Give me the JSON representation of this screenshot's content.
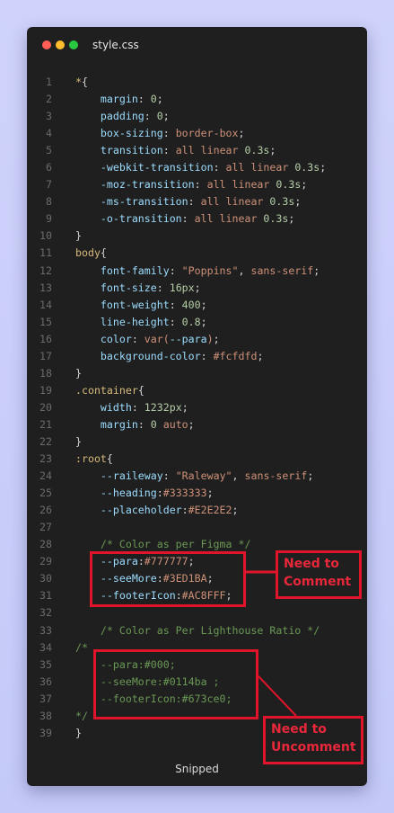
{
  "window": {
    "filename": "style.css",
    "footer": "Snipped"
  },
  "annotations": {
    "comment_label_1": "Need to",
    "comment_label_2": "Comment",
    "uncomment_label_1": "Need to",
    "uncomment_label_2": "Uncomment",
    "annotation_color": "#e0142a"
  },
  "code_lines": [
    {
      "n": "1",
      "parts": [
        [
          "sel",
          "*"
        ],
        [
          "punc",
          "{"
        ]
      ]
    },
    {
      "n": "2",
      "parts": [
        [
          "prop",
          "    margin"
        ],
        [
          "punc",
          ": "
        ],
        [
          "num",
          "0"
        ],
        [
          "punc",
          ";"
        ]
      ]
    },
    {
      "n": "3",
      "parts": [
        [
          "prop",
          "    padding"
        ],
        [
          "punc",
          ": "
        ],
        [
          "num",
          "0"
        ],
        [
          "punc",
          ";"
        ]
      ]
    },
    {
      "n": "4",
      "parts": [
        [
          "prop",
          "    box-sizing"
        ],
        [
          "punc",
          ": "
        ],
        [
          "val",
          "border-box"
        ],
        [
          "punc",
          ";"
        ]
      ]
    },
    {
      "n": "5",
      "parts": [
        [
          "prop",
          "    transition"
        ],
        [
          "punc",
          ": "
        ],
        [
          "val",
          "all linear "
        ],
        [
          "num",
          "0.3s"
        ],
        [
          "punc",
          ";"
        ]
      ]
    },
    {
      "n": "6",
      "parts": [
        [
          "prop",
          "    -webkit-transition"
        ],
        [
          "punc",
          ": "
        ],
        [
          "val",
          "all linear "
        ],
        [
          "num",
          "0.3s"
        ],
        [
          "punc",
          ";"
        ]
      ]
    },
    {
      "n": "7",
      "parts": [
        [
          "prop",
          "    -moz-transition"
        ],
        [
          "punc",
          ": "
        ],
        [
          "val",
          "all linear "
        ],
        [
          "num",
          "0.3s"
        ],
        [
          "punc",
          ";"
        ]
      ]
    },
    {
      "n": "8",
      "parts": [
        [
          "prop",
          "    -ms-transition"
        ],
        [
          "punc",
          ": "
        ],
        [
          "val",
          "all linear "
        ],
        [
          "num",
          "0.3s"
        ],
        [
          "punc",
          ";"
        ]
      ]
    },
    {
      "n": "9",
      "parts": [
        [
          "prop",
          "    -o-transition"
        ],
        [
          "punc",
          ": "
        ],
        [
          "val",
          "all linear "
        ],
        [
          "num",
          "0.3s"
        ],
        [
          "punc",
          ";"
        ]
      ]
    },
    {
      "n": "10",
      "parts": [
        [
          "punc",
          "}"
        ]
      ]
    },
    {
      "n": "11",
      "parts": [
        [
          "sel",
          "body"
        ],
        [
          "punc",
          "{"
        ]
      ]
    },
    {
      "n": "12",
      "parts": [
        [
          "prop",
          "    font-family"
        ],
        [
          "punc",
          ": "
        ],
        [
          "str",
          "\"Poppins\""
        ],
        [
          "punc",
          ", "
        ],
        [
          "val",
          "sans-serif"
        ],
        [
          "punc",
          ";"
        ]
      ]
    },
    {
      "n": "13",
      "parts": [
        [
          "prop",
          "    font-size"
        ],
        [
          "punc",
          ": "
        ],
        [
          "num",
          "16px"
        ],
        [
          "punc",
          ";"
        ]
      ]
    },
    {
      "n": "14",
      "parts": [
        [
          "prop",
          "    font-weight"
        ],
        [
          "punc",
          ": "
        ],
        [
          "num",
          "400"
        ],
        [
          "punc",
          ";"
        ]
      ]
    },
    {
      "n": "15",
      "parts": [
        [
          "prop",
          "    line-height"
        ],
        [
          "punc",
          ": "
        ],
        [
          "num",
          "0.8"
        ],
        [
          "punc",
          ";"
        ]
      ]
    },
    {
      "n": "16",
      "parts": [
        [
          "prop",
          "    color"
        ],
        [
          "punc",
          ": "
        ],
        [
          "val",
          "var("
        ],
        [
          "prop",
          "--para"
        ],
        [
          "val",
          ")"
        ],
        [
          "punc",
          ";"
        ]
      ]
    },
    {
      "n": "17",
      "parts": [
        [
          "prop",
          "    background-color"
        ],
        [
          "punc",
          ": "
        ],
        [
          "val",
          "#fcfdfd"
        ],
        [
          "punc",
          ";"
        ]
      ]
    },
    {
      "n": "18",
      "parts": [
        [
          "punc",
          "}"
        ]
      ]
    },
    {
      "n": "19",
      "parts": [
        [
          "sel",
          ".container"
        ],
        [
          "punc",
          "{"
        ]
      ]
    },
    {
      "n": "20",
      "parts": [
        [
          "prop",
          "    width"
        ],
        [
          "punc",
          ": "
        ],
        [
          "num",
          "1232px"
        ],
        [
          "punc",
          ";"
        ]
      ]
    },
    {
      "n": "21",
      "parts": [
        [
          "prop",
          "    margin"
        ],
        [
          "punc",
          ": "
        ],
        [
          "num",
          "0"
        ],
        [
          "val",
          " auto"
        ],
        [
          "punc",
          ";"
        ]
      ]
    },
    {
      "n": "22",
      "parts": [
        [
          "punc",
          "}"
        ]
      ]
    },
    {
      "n": "23",
      "parts": [
        [
          "sel",
          ":root"
        ],
        [
          "punc",
          "{"
        ]
      ]
    },
    {
      "n": "24",
      "parts": [
        [
          "prop",
          "    --raileway"
        ],
        [
          "punc",
          ": "
        ],
        [
          "str",
          "\"Raleway\""
        ],
        [
          "punc",
          ", "
        ],
        [
          "val",
          "sans-serif"
        ],
        [
          "punc",
          ";"
        ]
      ]
    },
    {
      "n": "25",
      "parts": [
        [
          "prop",
          "    --heading"
        ],
        [
          "punc",
          ":"
        ],
        [
          "val",
          "#333333"
        ],
        [
          "punc",
          ";"
        ]
      ]
    },
    {
      "n": "26",
      "parts": [
        [
          "prop",
          "    --placeholder"
        ],
        [
          "punc",
          ":"
        ],
        [
          "val",
          "#E2E2E2"
        ],
        [
          "punc",
          ";"
        ]
      ]
    },
    {
      "n": "27",
      "parts": []
    },
    {
      "n": "28",
      "parts": [
        [
          "cmt",
          "    /* Color as per Figma */"
        ]
      ]
    },
    {
      "n": "29",
      "parts": [
        [
          "prop",
          "    --para"
        ],
        [
          "punc",
          ":"
        ],
        [
          "val",
          "#777777"
        ],
        [
          "punc",
          ";"
        ]
      ]
    },
    {
      "n": "30",
      "parts": [
        [
          "prop",
          "    --seeMore"
        ],
        [
          "punc",
          ":"
        ],
        [
          "val",
          "#3ED1BA"
        ],
        [
          "punc",
          ";"
        ]
      ]
    },
    {
      "n": "31",
      "parts": [
        [
          "prop",
          "    --footerIcon"
        ],
        [
          "punc",
          ":"
        ],
        [
          "val",
          "#AC8FFF"
        ],
        [
          "punc",
          ";"
        ]
      ]
    },
    {
      "n": "32",
      "parts": []
    },
    {
      "n": "33",
      "parts": [
        [
          "cmt",
          "    /* Color as Per Lighthouse Ratio */"
        ]
      ]
    },
    {
      "n": "34",
      "parts": [
        [
          "cmt",
          "/*"
        ]
      ]
    },
    {
      "n": "35",
      "parts": [
        [
          "cmt",
          "    --para:#000;"
        ]
      ]
    },
    {
      "n": "36",
      "parts": [
        [
          "cmt",
          "    --seeMore:#0114ba ;"
        ]
      ]
    },
    {
      "n": "37",
      "parts": [
        [
          "cmt",
          "    --footerIcon:#673ce0;"
        ]
      ]
    },
    {
      "n": "38",
      "parts": [
        [
          "cmt",
          "*/"
        ]
      ]
    },
    {
      "n": "39",
      "parts": [
        [
          "punc",
          "}"
        ]
      ]
    }
  ]
}
